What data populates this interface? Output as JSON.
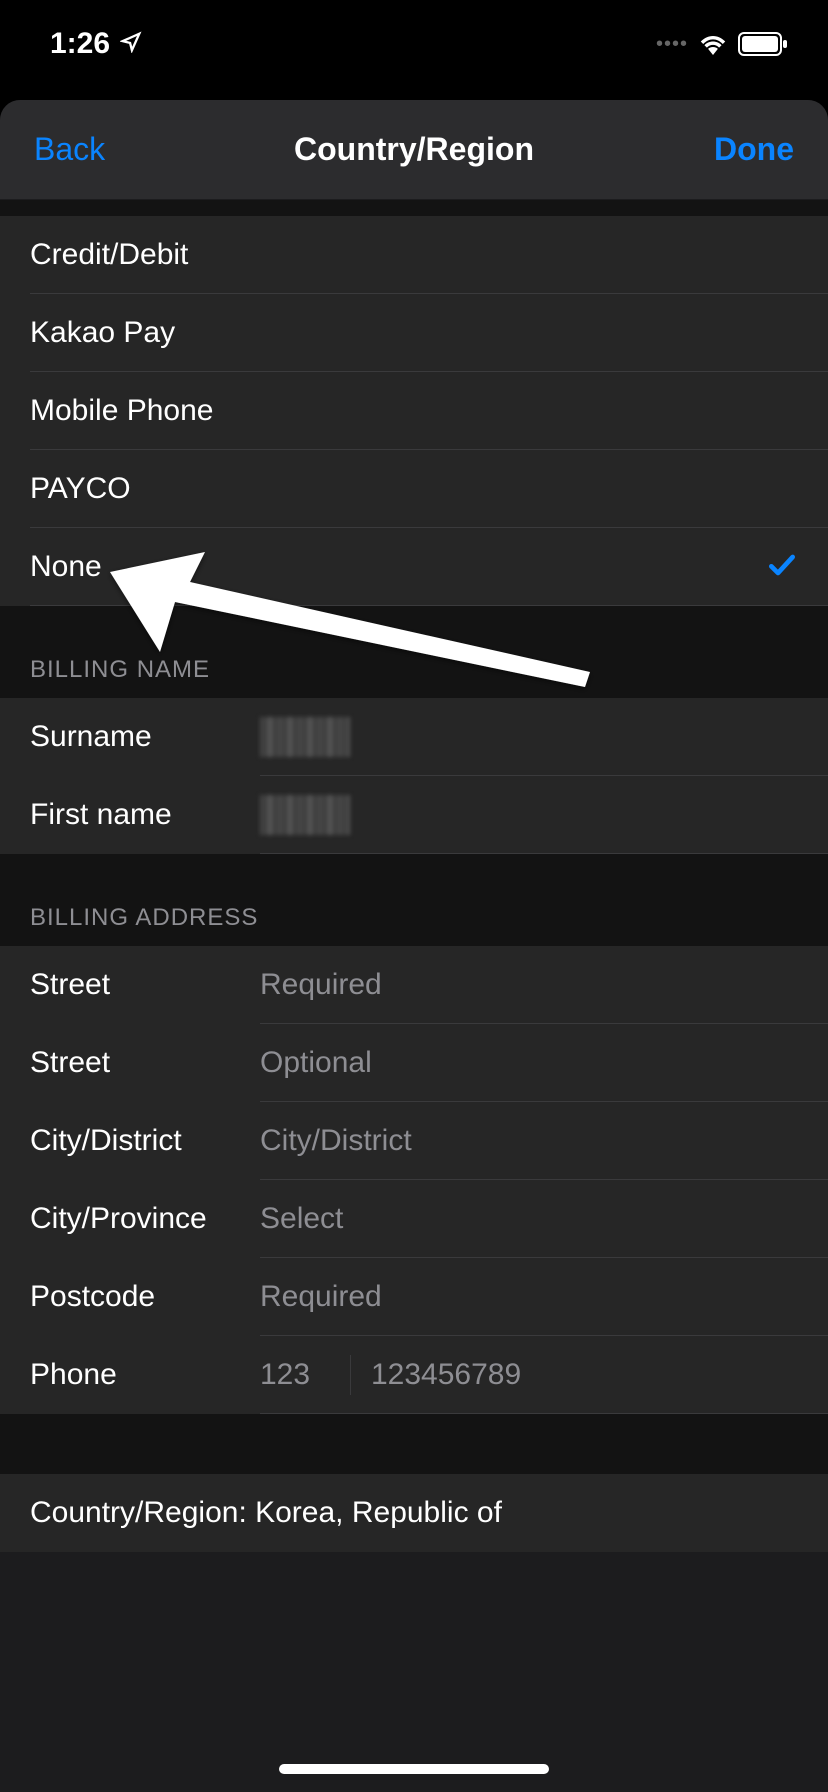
{
  "status_bar": {
    "time": "1:26"
  },
  "nav": {
    "back": "Back",
    "title": "Country/Region",
    "done": "Done"
  },
  "payment_methods": [
    {
      "label": "Credit/Debit",
      "selected": false
    },
    {
      "label": "Kakao Pay",
      "selected": false
    },
    {
      "label": "Mobile Phone",
      "selected": false
    },
    {
      "label": "PAYCO",
      "selected": false
    },
    {
      "label": "None",
      "selected": true
    }
  ],
  "sections": {
    "billing_name_header": "BILLING NAME",
    "billing_address_header": "BILLING ADDRESS"
  },
  "billing_name": {
    "surname_label": "Surname",
    "first_name_label": "First name"
  },
  "billing_address": {
    "street1_label": "Street",
    "street1_placeholder": "Required",
    "street2_label": "Street",
    "street2_placeholder": "Optional",
    "city_district_label": "City/District",
    "city_district_placeholder": "City/District",
    "city_province_label": "City/Province",
    "city_province_placeholder": "Select",
    "postcode_label": "Postcode",
    "postcode_placeholder": "Required",
    "phone_label": "Phone",
    "phone_cc_placeholder": "123",
    "phone_number_placeholder": "123456789"
  },
  "country_row": {
    "label": "Country/Region: Korea, Republic of"
  }
}
